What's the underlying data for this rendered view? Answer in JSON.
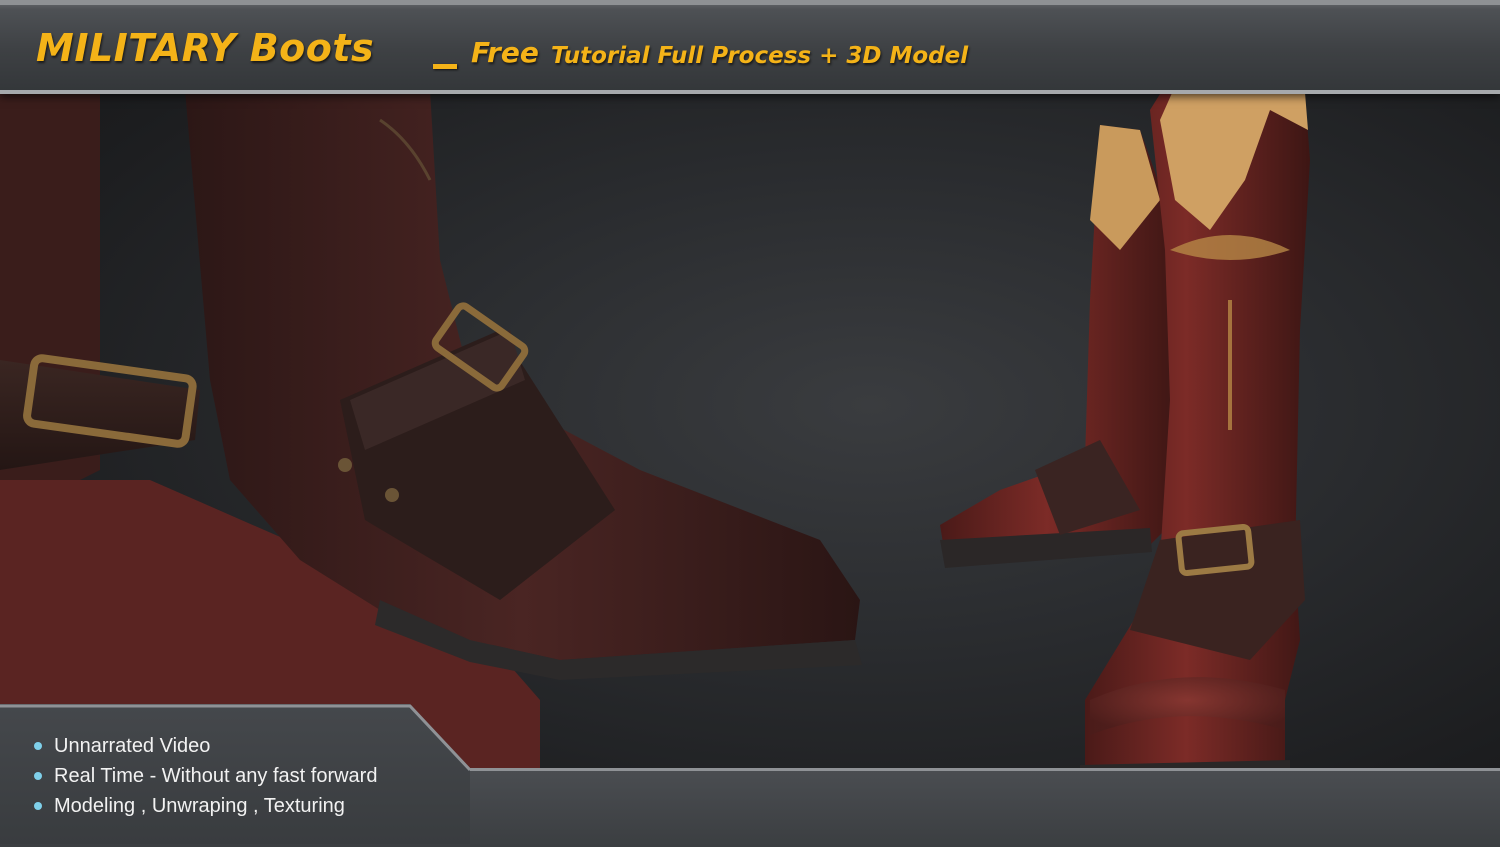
{
  "banner": {
    "title_main": "MILITARY  Boots",
    "title_free": "Free",
    "title_sub": "Tutorial Full Process + 3D Model"
  },
  "features": [
    "Unnarrated Video",
    "Real Time - Without any fast forward",
    "Modeling , Unwraping , Texturing"
  ],
  "colors": {
    "accent": "#f4b318",
    "bullet": "#7fd0ea",
    "leather": "#6b2a28",
    "background": "#2a2c2f"
  }
}
